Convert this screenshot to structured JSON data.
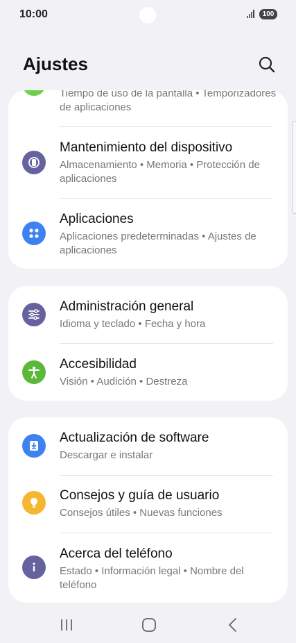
{
  "status_bar": {
    "time": "10:00",
    "battery": "100"
  },
  "header": {
    "title": "Ajustes"
  },
  "groups": [
    {
      "items": [
        {
          "title": "",
          "subtitle": "Tiempo de uso de la pantalla • Temporizadores de aplicaciones",
          "icon": "digital-wellbeing-icon"
        },
        {
          "title": "Mantenimiento del dispositivo",
          "subtitle": "Almacenamiento • Memoria • Protección de aplicaciones",
          "icon": "device-care-icon"
        },
        {
          "title": "Aplicaciones",
          "subtitle": "Aplicaciones predeterminadas • Ajustes de aplicaciones",
          "icon": "apps-icon"
        }
      ]
    },
    {
      "items": [
        {
          "title": "Administración general",
          "subtitle": "Idioma y teclado • Fecha y hora",
          "icon": "sliders-icon"
        },
        {
          "title": "Accesibilidad",
          "subtitle": "Visión • Audición • Destreza",
          "icon": "accessibility-icon"
        }
      ]
    },
    {
      "items": [
        {
          "title": "Actualización de software",
          "subtitle": "Descargar e instalar",
          "icon": "software-update-icon"
        },
        {
          "title": "Consejos y guía de usuario",
          "subtitle": "Consejos útiles • Nuevas funciones",
          "icon": "lightbulb-icon"
        },
        {
          "title": "Acerca del teléfono",
          "subtitle": "Estado • Información legal • Nombre del teléfono",
          "icon": "info-icon"
        }
      ]
    }
  ],
  "colors": {
    "background": "#f2f2f6",
    "card": "#ffffff",
    "green": "#6fcf4a",
    "purple": "#66629e",
    "blue": "#3d82f0",
    "accessibility_green": "#5cb83a",
    "yellow": "#f5b731"
  },
  "nav_bar": {
    "icons": [
      "recents-icon",
      "home-icon",
      "back-icon"
    ]
  }
}
